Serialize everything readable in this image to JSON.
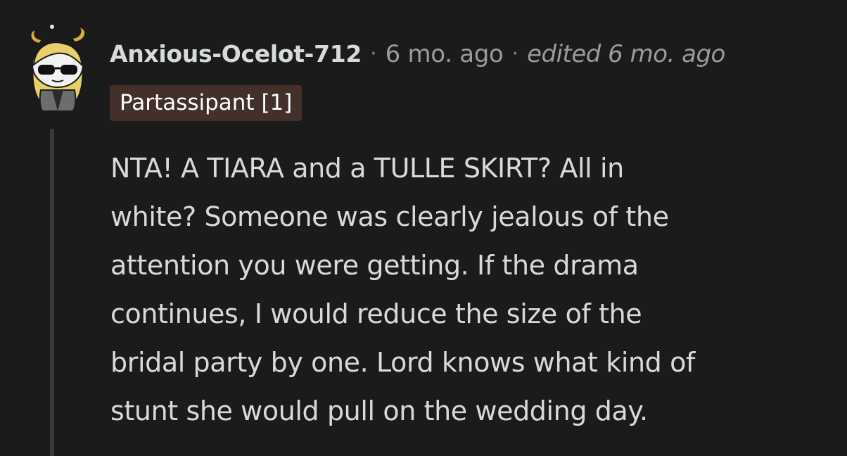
{
  "comment": {
    "author": "Anxious-Ocelot-712",
    "separator": "·",
    "timestamp": "6 mo. ago",
    "edited": "edited 6 mo. ago",
    "flair": "Partassipant [1]",
    "body_lines": [
      "NTA! A TIARA and a TULLE SKIRT? All in",
      "white? Someone was clearly jealous of the",
      "attention you were getting. If the drama",
      "continues, I would reduce the size of the",
      "bridal party by one. Lord knows what kind of",
      "stunt she would pull on the wedding day."
    ]
  },
  "colors": {
    "background": "#1b1b1b",
    "text": "#d7dadc",
    "meta": "#9a9c9e",
    "flair_bg": "#43302a",
    "thread_line": "#3a3a3a"
  },
  "icons": {
    "avatar": "snoo-avatar-with-sunglasses-and-horns"
  }
}
